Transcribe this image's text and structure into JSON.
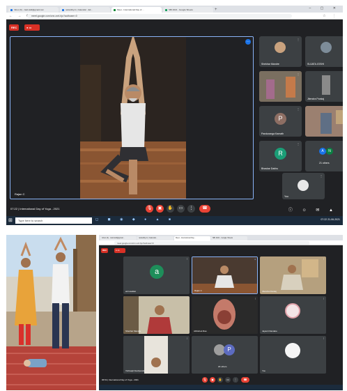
{
  "top_meet": {
    "tabs": [
      {
        "label": "Inbox (6) - zaid.sidd@gmail.com",
        "active": false
      },
      {
        "label": "nelsutility.in | Calendar - Ed...",
        "active": false
      },
      {
        "label": "Meet - International Day of ...",
        "active": true
      },
      {
        "label": "SBI 2021 - Google Sheets",
        "active": false
      }
    ],
    "url": "meet.google.com/cnn-xxrt-hjo?authuser=0",
    "rec_label": "REC",
    "live_label": "",
    "main_speaker_name": "Rajan C",
    "participants": [
      {
        "name": "Shekhar Mandre",
        "type": "photo"
      },
      {
        "name": "SUJATA JOSHI",
        "type": "photo"
      },
      {
        "name": "",
        "type": "photo"
      },
      {
        "name": "Jitendra Pankaj",
        "type": "photo"
      },
      {
        "name": "Panduranga Kamath",
        "type": "avatar",
        "initial": "P",
        "color": "#8d6e63"
      },
      {
        "name": "",
        "type": "photo"
      },
      {
        "name": "Bhaskar Dabhu",
        "type": "avatar",
        "initial": "R",
        "color": "#1b9e77"
      },
      {
        "name": "21 others",
        "type": "others"
      },
      {
        "name": "You",
        "type": "self"
      }
    ],
    "meeting_time": "07:22",
    "meeting_title": "International Day of Yoga - 2021",
    "search_placeholder": "Type here to search",
    "clock_time": "07:22",
    "clock_date": "21-06-2021"
  },
  "bottom_meet": {
    "tabs": [
      {
        "label": "Inbox (6) - zaid.sidd@gmail...",
        "active": false
      },
      {
        "label": "nelsutility.in | Calendar...",
        "active": false
      },
      {
        "label": "Meet - International Day...",
        "active": true
      },
      {
        "label": "SBI 2021 - Google Sheets",
        "active": false
      }
    ],
    "url": "meet.google.com/cnn-xxrt-hjo?authuser=0",
    "rec_label": "REC",
    "participants": [
      {
        "name": "anil asalkar",
        "type": "avatar",
        "initial": "a",
        "color": "#1e8e5a"
      },
      {
        "name": "Rajan C",
        "type": "photo",
        "active": true
      },
      {
        "name": "Jitendra Pankaj",
        "type": "photo"
      },
      {
        "name": "Shekhar Mandre",
        "type": "photo"
      },
      {
        "name": "Abhishek Rao",
        "type": "photo"
      },
      {
        "name": "Jayanti Dandare",
        "type": "photo"
      },
      {
        "name": "Vishwajit Deshpande",
        "type": "photo"
      },
      {
        "name": "20 others",
        "type": "others"
      },
      {
        "name": "You",
        "type": "self"
      }
    ],
    "meeting_time": "06:54",
    "meeting_title": "International Day of Yoga - 2021"
  }
}
